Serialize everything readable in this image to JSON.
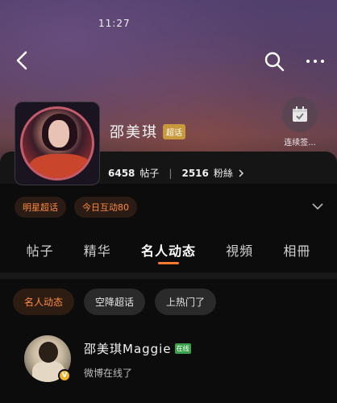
{
  "status_bar": {
    "time": "11:27"
  },
  "header": {
    "icons": [
      "back-arrow-icon",
      "search-icon",
      "more-icon"
    ]
  },
  "profile": {
    "name": "邵美琪",
    "badge": "超话",
    "posts_count": "6458",
    "posts_label": "帖子",
    "fans_count": "2516",
    "fans_label": "粉絲",
    "checkin_label": "连续签..."
  },
  "tags": [
    {
      "label": "明星超话"
    },
    {
      "label": "今日互动80"
    }
  ],
  "tabs": [
    {
      "label": "帖子"
    },
    {
      "label": "精华"
    },
    {
      "label": "名人动态",
      "active": true
    },
    {
      "label": "視頻"
    },
    {
      "label": "相冊"
    }
  ],
  "filters": [
    {
      "label": "名人动态",
      "active": true
    },
    {
      "label": "空降超话"
    },
    {
      "label": "上热门了"
    }
  ],
  "post": {
    "author": "邵美琪Maggie",
    "online_badge": "在线",
    "status": "微博在线了",
    "verified_badge": "V"
  },
  "colors": {
    "accent": "#ff7a2e",
    "badge_gold": "#c99a3d",
    "online_green": "#3aa14a"
  }
}
